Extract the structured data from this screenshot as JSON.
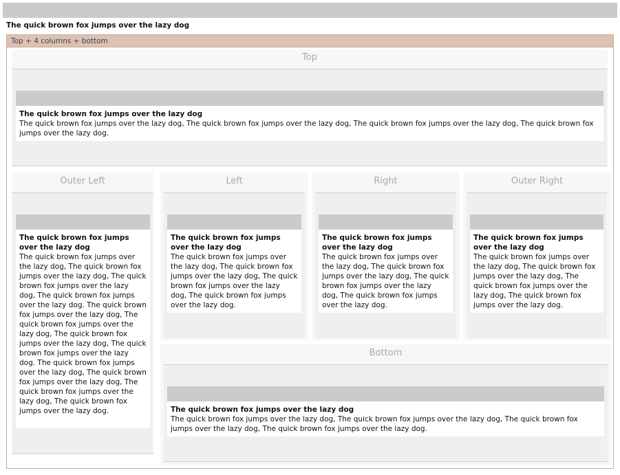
{
  "page": {
    "title": "The quick brown fox jumps over the lazy dog"
  },
  "layout": {
    "label": "Top + 4 columns + bottom"
  },
  "regions": {
    "top": {
      "title": "Top",
      "card_title": "The quick brown fox jumps over the lazy dog",
      "card_text": "The quick brown fox jumps over the lazy dog, The quick brown fox jumps over the lazy dog, The quick brown fox jumps over the lazy dog, The quick brown fox jumps over the lazy dog."
    },
    "outer_left": {
      "title": "Outer Left",
      "card_title": "The quick brown fox jumps over the lazy dog",
      "card_text": "The quick brown fox jumps over the lazy dog, The quick brown fox jumps over the lazy dog, The quick brown fox jumps over the lazy dog, The quick brown fox jumps over the lazy dog. The quick brown fox jumps over the lazy dog, The quick brown fox jumps over the lazy dog, The quick brown fox jumps over the lazy dog, The quick brown fox jumps over the lazy dog. The quick brown fox jumps over the lazy dog, The quick brown fox jumps over the lazy dog, The quick brown fox jumps over the lazy dog, The quick brown fox jumps over the lazy dog."
    },
    "left": {
      "title": "Left",
      "card_title": "The quick brown fox jumps over the lazy dog",
      "card_text": "The quick brown fox jumps over the lazy dog, The quick brown fox jumps over the lazy dog, The quick brown fox jumps over the lazy dog, The quick brown fox jumps over the lazy dog."
    },
    "right": {
      "title": "Right",
      "card_title": "The quick brown fox jumps over the lazy dog",
      "card_text": "The quick brown fox jumps over the lazy dog, The quick brown fox jumps over the lazy dog, The quick brown fox jumps over the lazy dog, The quick brown fox jumps over the lazy dog."
    },
    "outer_right": {
      "title": "Outer Right",
      "card_title": "The quick brown fox jumps over the lazy dog",
      "card_text": "The quick brown fox jumps over the lazy dog, The quick brown fox jumps over the lazy dog, The quick brown fox jumps over the lazy dog, The quick brown fox jumps over the lazy dog."
    },
    "bottom": {
      "title": "Bottom",
      "card_title": "The quick brown fox jumps over the lazy dog",
      "card_text": "The quick brown fox jumps over the lazy dog, The quick brown fox jumps over the lazy dog, The quick brown fox jumps over the lazy dog, The quick brown fox jumps over the lazy dog."
    }
  },
  "colors": {
    "bar": "#cbcbcb",
    "layout_header": "#dcc2b4",
    "layout_border": "#c8a898",
    "region_title": "#a8a8a8"
  }
}
